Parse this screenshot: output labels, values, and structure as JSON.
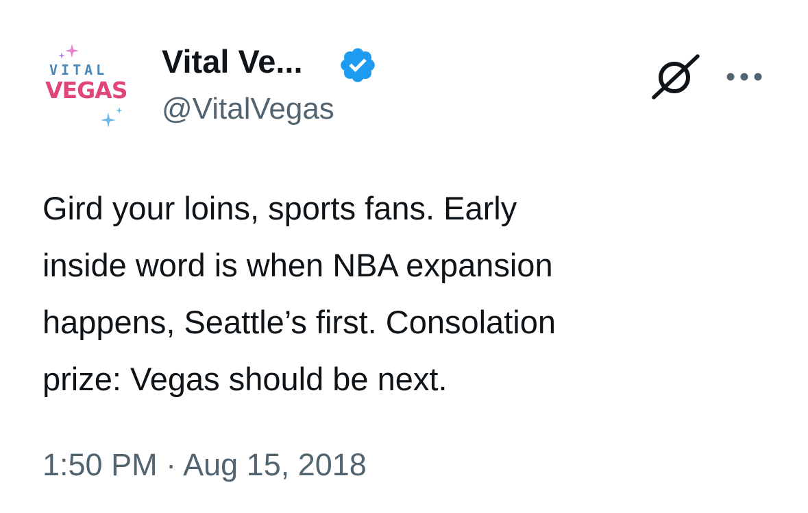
{
  "tweet": {
    "avatar": {
      "logo_top": "VITAL",
      "logo_bottom": "VEGAS",
      "colors": {
        "top_text": "#4a87b8",
        "bottom_text": "#e0457b",
        "sparkle_pink": "#e77fd3",
        "sparkle_blue": "#69b8e6"
      }
    },
    "author": {
      "display_name": "Vital Ve...",
      "handle": "@VitalVegas",
      "verified_icon": "verified-badge-icon",
      "verified_color": "#1d9bf0"
    },
    "actions": {
      "grok_icon": "grok-icon",
      "more_icon": "more-options-icon"
    },
    "text_lines": [
      "Gird your loins, sports fans. Early",
      "inside word is when NBA expansion",
      "happens, Seattle’s first. Consolation",
      "prize: Vegas should be next."
    ],
    "timestamp": "1:50 PM · Aug 15, 2018",
    "colors": {
      "primary_text": "#0f1419",
      "secondary_text": "#536471",
      "background": "#ffffff"
    }
  }
}
